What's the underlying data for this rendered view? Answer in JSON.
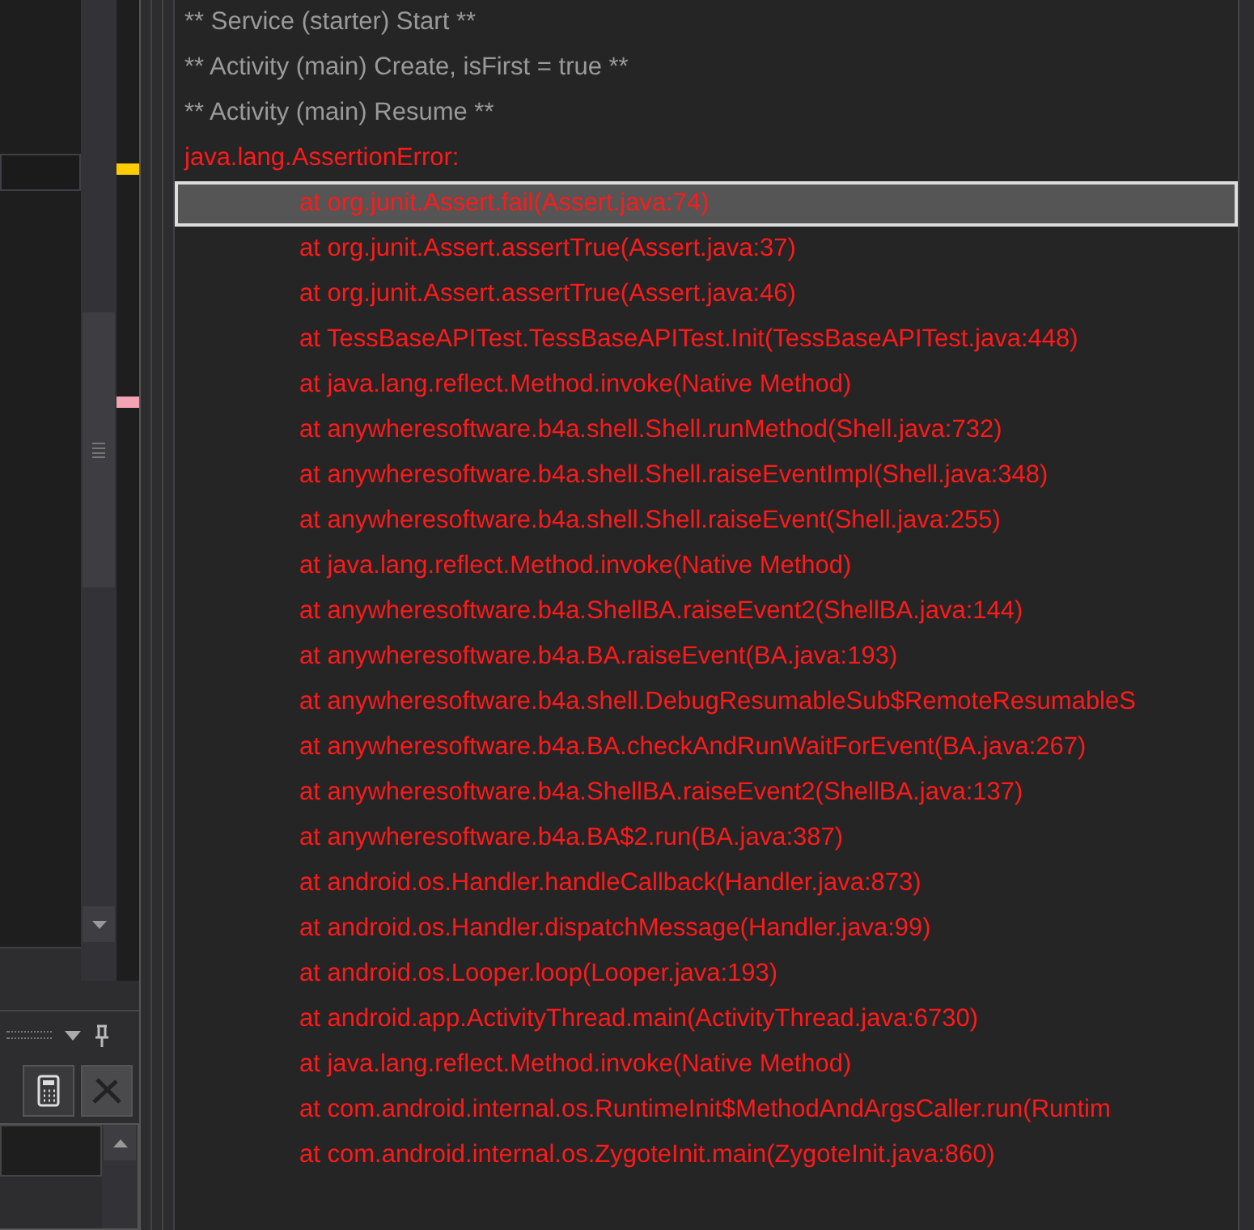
{
  "log": {
    "lines": [
      {
        "kind": "info",
        "indent": false,
        "selected": false,
        "text": "** Service (starter) Start **"
      },
      {
        "kind": "info",
        "indent": false,
        "selected": false,
        "text": "** Activity (main) Create, isFirst = true **"
      },
      {
        "kind": "info",
        "indent": false,
        "selected": false,
        "text": "** Activity (main) Resume **"
      },
      {
        "kind": "error",
        "indent": false,
        "selected": false,
        "text": "java.lang.AssertionError:"
      },
      {
        "kind": "error",
        "indent": true,
        "selected": true,
        "text": "at org.junit.Assert.fail(Assert.java:74)"
      },
      {
        "kind": "error",
        "indent": true,
        "selected": false,
        "text": "at org.junit.Assert.assertTrue(Assert.java:37)"
      },
      {
        "kind": "error",
        "indent": true,
        "selected": false,
        "text": "at org.junit.Assert.assertTrue(Assert.java:46)"
      },
      {
        "kind": "error",
        "indent": true,
        "selected": false,
        "text": "at TessBaseAPITest.TessBaseAPITest.Init(TessBaseAPITest.java:448)"
      },
      {
        "kind": "error",
        "indent": true,
        "selected": false,
        "text": "at java.lang.reflect.Method.invoke(Native Method)"
      },
      {
        "kind": "error",
        "indent": true,
        "selected": false,
        "text": "at anywheresoftware.b4a.shell.Shell.runMethod(Shell.java:732)"
      },
      {
        "kind": "error",
        "indent": true,
        "selected": false,
        "text": "at anywheresoftware.b4a.shell.Shell.raiseEventImpl(Shell.java:348)"
      },
      {
        "kind": "error",
        "indent": true,
        "selected": false,
        "text": "at anywheresoftware.b4a.shell.Shell.raiseEvent(Shell.java:255)"
      },
      {
        "kind": "error",
        "indent": true,
        "selected": false,
        "text": "at java.lang.reflect.Method.invoke(Native Method)"
      },
      {
        "kind": "error",
        "indent": true,
        "selected": false,
        "text": "at anywheresoftware.b4a.ShellBA.raiseEvent2(ShellBA.java:144)"
      },
      {
        "kind": "error",
        "indent": true,
        "selected": false,
        "text": "at anywheresoftware.b4a.BA.raiseEvent(BA.java:193)"
      },
      {
        "kind": "error",
        "indent": true,
        "selected": false,
        "text": "at anywheresoftware.b4a.shell.DebugResumableSub$RemoteResumableS"
      },
      {
        "kind": "error",
        "indent": true,
        "selected": false,
        "text": "at anywheresoftware.b4a.BA.checkAndRunWaitForEvent(BA.java:267)"
      },
      {
        "kind": "error",
        "indent": true,
        "selected": false,
        "text": "at anywheresoftware.b4a.ShellBA.raiseEvent2(ShellBA.java:137)"
      },
      {
        "kind": "error",
        "indent": true,
        "selected": false,
        "text": "at anywheresoftware.b4a.BA$2.run(BA.java:387)"
      },
      {
        "kind": "error",
        "indent": true,
        "selected": false,
        "text": "at android.os.Handler.handleCallback(Handler.java:873)"
      },
      {
        "kind": "error",
        "indent": true,
        "selected": false,
        "text": "at android.os.Handler.dispatchMessage(Handler.java:99)"
      },
      {
        "kind": "error",
        "indent": true,
        "selected": false,
        "text": "at android.os.Looper.loop(Looper.java:193)"
      },
      {
        "kind": "error",
        "indent": true,
        "selected": false,
        "text": "at android.app.ActivityThread.main(ActivityThread.java:6730)"
      },
      {
        "kind": "error",
        "indent": true,
        "selected": false,
        "text": "at java.lang.reflect.Method.invoke(Native Method)"
      },
      {
        "kind": "error",
        "indent": true,
        "selected": false,
        "text": "at com.android.internal.os.RuntimeInit$MethodAndArgsCaller.run(Runtim"
      },
      {
        "kind": "error",
        "indent": true,
        "selected": false,
        "text": "at com.android.internal.os.ZygoteInit.main(ZygoteInit.java:860)"
      }
    ]
  }
}
